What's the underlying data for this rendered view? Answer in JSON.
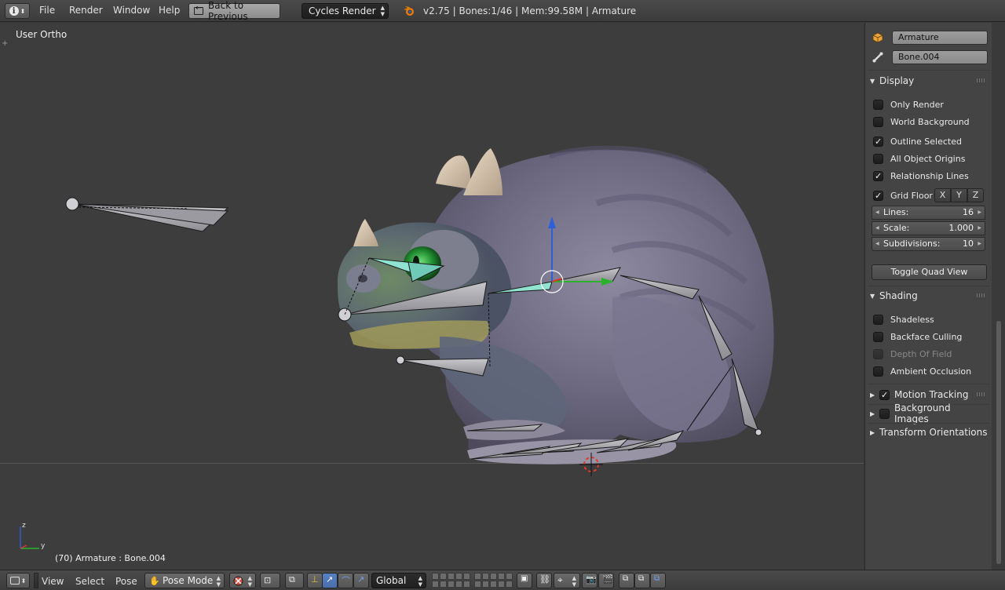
{
  "top_header": {
    "menus": [
      "File",
      "Render",
      "Window",
      "Help"
    ],
    "back_button": "Back to Previous",
    "render_engine": "Cycles Render",
    "stats": "v2.75 | Bones:1/46  | Mem:99.58M | Armature"
  },
  "viewport": {
    "view_label": "User Ortho",
    "status": "(70) Armature : Bone.004",
    "gizmo_axes": {
      "z": "z",
      "y": "y"
    }
  },
  "properties": {
    "object_name": "Armature",
    "bone_name": "Bone.004",
    "display": {
      "title": "Display",
      "options": [
        {
          "label": "Only Render",
          "checked": false
        },
        {
          "label": "World Background",
          "checked": false
        },
        {
          "label": "Outline Selected",
          "checked": true
        },
        {
          "label": "All Object Origins",
          "checked": false
        },
        {
          "label": "Relationship Lines",
          "checked": true
        }
      ],
      "grid_floor": {
        "label": "Grid Floor",
        "checked": true,
        "axes": [
          "X",
          "Y",
          "Z"
        ]
      },
      "lines": {
        "label": "Lines:",
        "value": "16"
      },
      "scale": {
        "label": "Scale:",
        "value": "1.000"
      },
      "subdivisions": {
        "label": "Subdivisions:",
        "value": "10"
      },
      "toggle_quad": "Toggle Quad View"
    },
    "shading": {
      "title": "Shading",
      "options": [
        {
          "label": "Shadeless",
          "checked": false,
          "disabled": false
        },
        {
          "label": "Backface Culling",
          "checked": false,
          "disabled": false
        },
        {
          "label": "Depth Of Field",
          "checked": false,
          "disabled": true
        },
        {
          "label": "Ambient Occlusion",
          "checked": false,
          "disabled": false
        }
      ]
    },
    "collapsed_panels": [
      {
        "label": "Motion Tracking",
        "checkbox": true,
        "checked": true
      },
      {
        "label": "Background Images",
        "checkbox": true,
        "checked": false
      },
      {
        "label": "Transform Orientations",
        "checkbox": false,
        "checked": false
      }
    ]
  },
  "bottom_header": {
    "menus": [
      "View",
      "Select",
      "Pose"
    ],
    "mode": "Pose Mode",
    "orientation": "Global"
  },
  "colors": {
    "viewport_bg": "#3d3d3d",
    "panel_bg": "#444444",
    "bone_fill": "#a9a9ad",
    "selected_bone": "#8fe3d0",
    "axis_z": "#2f5fd8",
    "axis_y": "#2cb12c",
    "axis_x": "#d83a2c"
  }
}
